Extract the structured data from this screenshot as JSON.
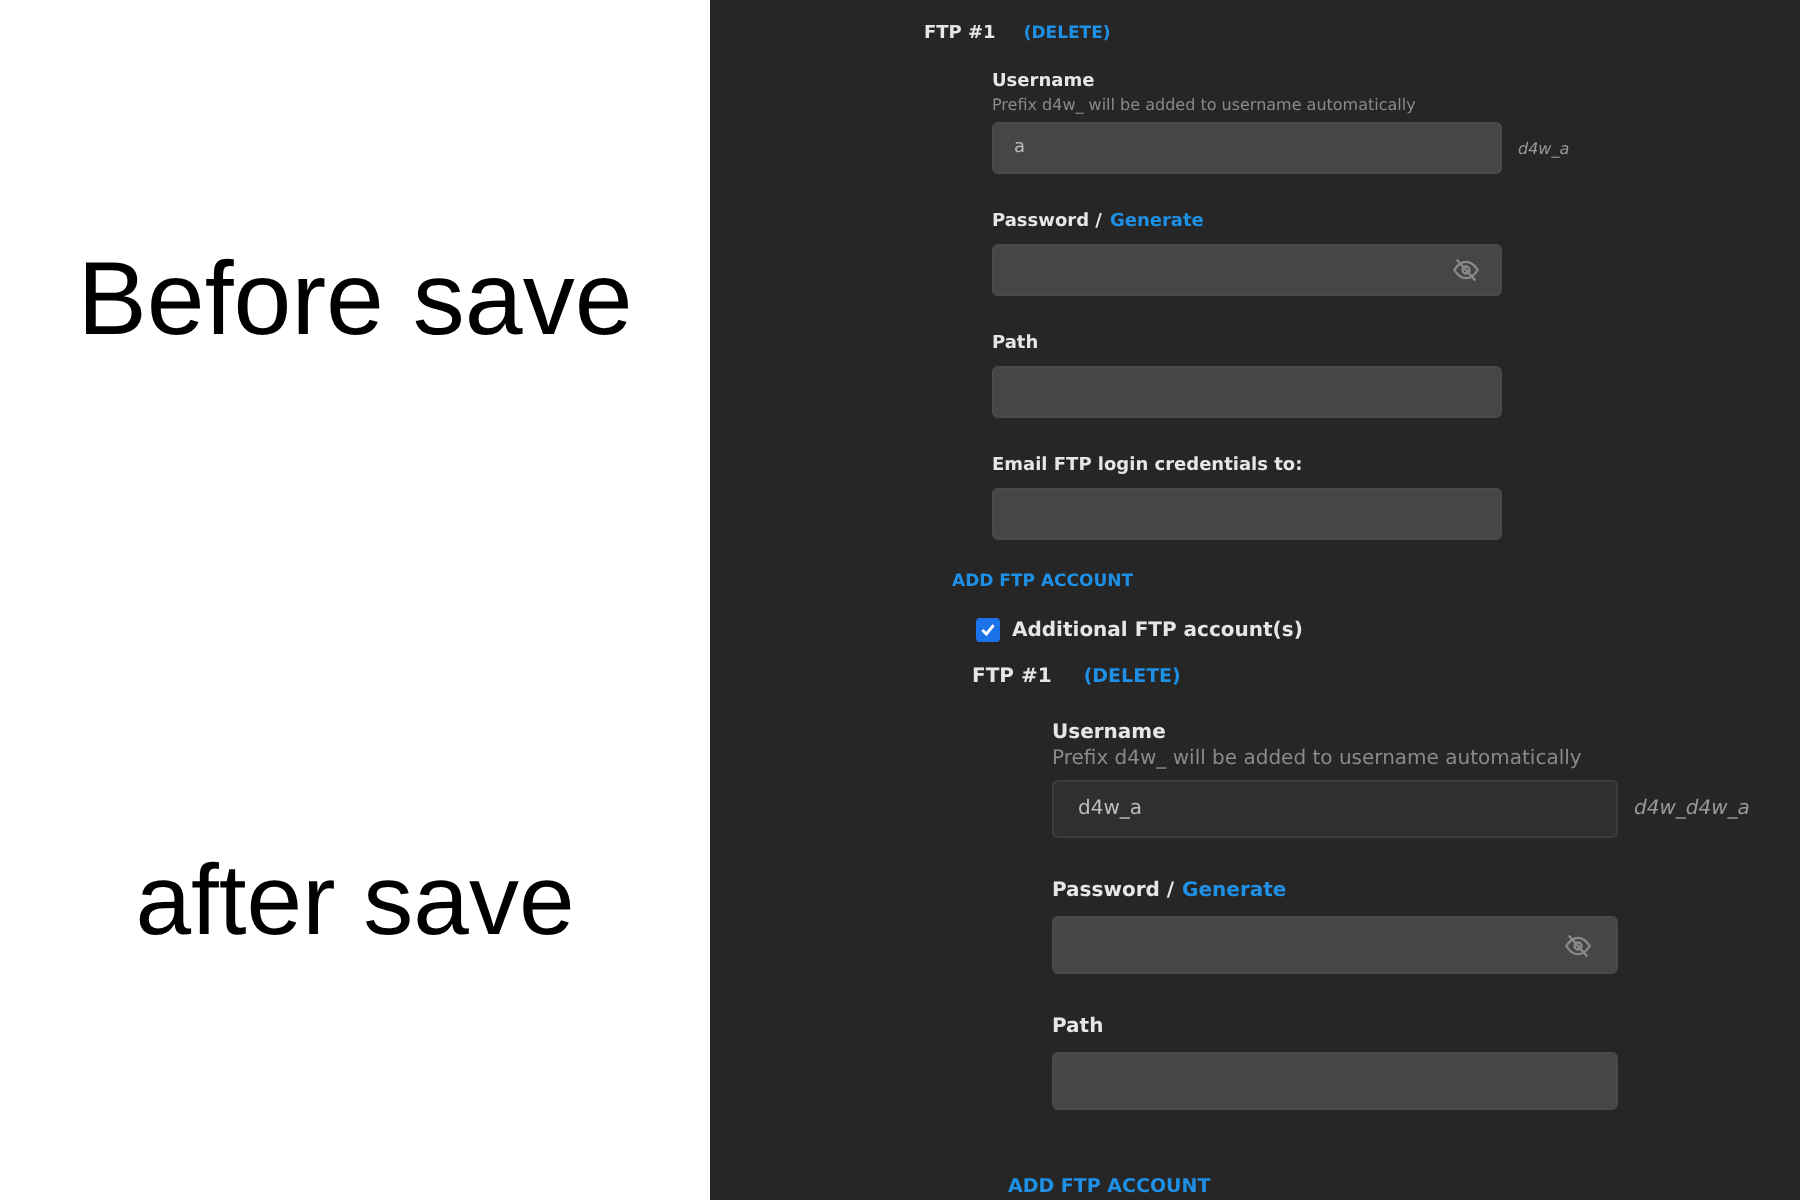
{
  "captions": [
    "Before save",
    "after save"
  ],
  "panels": [
    {
      "account": {
        "title": "FTP #1",
        "delete": "(DELETE)"
      },
      "fields": [
        {
          "kind": "username",
          "label": "Username",
          "hint": "Prefix d4w_ will be added to username automatically",
          "value": "a",
          "suffix": "d4w_a"
        },
        {
          "kind": "password",
          "label": "Password /",
          "link": "Generate"
        },
        {
          "kind": "plain",
          "label": "Path"
        },
        {
          "kind": "plain",
          "label": "Email FTP login credentials to:"
        }
      ],
      "add": "ADD FTP ACCOUNT"
    },
    {
      "checkbox": {
        "label": "Additional FTP account(s)",
        "checked": true
      },
      "account": {
        "title": "FTP #1",
        "delete": "(DELETE)"
      },
      "fields": [
        {
          "kind": "username",
          "label": "Username",
          "hint": "Prefix d4w_ will be added to username automatically",
          "value": "d4w_a",
          "suffix": "d4w_d4w_a"
        },
        {
          "kind": "password",
          "label": "Password /",
          "link": "Generate"
        },
        {
          "kind": "plain",
          "label": "Path"
        }
      ],
      "add": "ADD FTP ACCOUNT"
    }
  ]
}
